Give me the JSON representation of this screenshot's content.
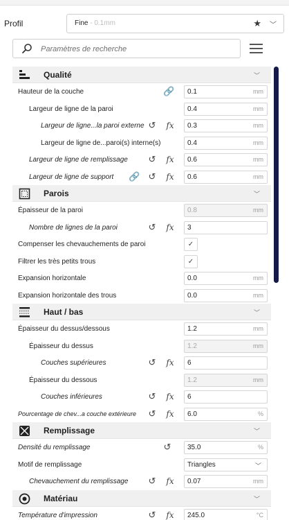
{
  "profile": {
    "label": "Profil",
    "value": "Fine",
    "sub": " - 0.1mm",
    "star_icon": "star-icon",
    "chevron_icon": "chevron-down-icon"
  },
  "search": {
    "placeholder": "Paramètres de recherche",
    "icon": "search-icon",
    "menu_icon": "menu-icon"
  },
  "colors": {
    "scrollbar": "#151a4a",
    "category_bg": "#f0f0f0",
    "disabled_field_bg": "#f3f3f3"
  },
  "categories": {
    "qualite": {
      "title": "Qualité",
      "icon": "quality-icon",
      "rows": {
        "r0": {
          "label": "Hauteur de la couche",
          "value": "0.1",
          "unit": "mm"
        },
        "r1": {
          "label": "Largeur de ligne de la paroi",
          "value": "0.4",
          "unit": "mm"
        },
        "r2": {
          "label": "Largeur de ligne...la paroi externe",
          "value": "0.3",
          "unit": "mm"
        },
        "r3": {
          "label": "Largeur de ligne de...paroi(s) interne(s)",
          "value": "0.4",
          "unit": "mm"
        },
        "r4": {
          "label": "Largeur de ligne de remplissage",
          "value": "0.6",
          "unit": "mm"
        },
        "r5": {
          "label": "Largeur de ligne de support",
          "value": "0.6",
          "unit": "mm"
        }
      }
    },
    "parois": {
      "title": "Parois",
      "icon": "walls-icon",
      "rows": {
        "r0": {
          "label": "Épaisseur de la paroi",
          "value": "0.8",
          "unit": "mm"
        },
        "r1": {
          "label": "Nombre de lignes de la paroi",
          "value": "3",
          "unit": ""
        },
        "r2": {
          "label": "Compenser les chevauchements de paroi",
          "checked": true
        },
        "r3": {
          "label": "Filtrer les très petits trous",
          "checked": true
        },
        "r4": {
          "label": "Expansion horizontale",
          "value": "0.0",
          "unit": "mm"
        },
        "r5": {
          "label": "Expansion horizontale des trous",
          "value": "0.0",
          "unit": "mm"
        }
      }
    },
    "hautbas": {
      "title": "Haut / bas",
      "icon": "top-bottom-icon",
      "rows": {
        "r0": {
          "label": "Épaisseur du dessus/dessous",
          "value": "1.2",
          "unit": "mm"
        },
        "r1": {
          "label": "Épaisseur du dessus",
          "value": "1.2",
          "unit": "mm"
        },
        "r2": {
          "label": "Couches supérieures",
          "value": "6",
          "unit": ""
        },
        "r3": {
          "label": "Épaisseur du dessous",
          "value": "1.2",
          "unit": "mm"
        },
        "r4": {
          "label": "Couches inférieures",
          "value": "6",
          "unit": ""
        },
        "r5": {
          "label": "Pourcentage de chev...a couche extérieure",
          "value": "6.0",
          "unit": "%"
        }
      }
    },
    "remplissage": {
      "title": "Remplissage",
      "icon": "infill-icon",
      "rows": {
        "r0": {
          "label": "Densité du remplissage",
          "value": "35.0",
          "unit": "%"
        },
        "r1": {
          "label": "Motif de remplissage",
          "value": "Triangles"
        },
        "r2": {
          "label": "Chevauchement du remplissage",
          "value": "0.07",
          "unit": "mm"
        }
      }
    },
    "materiau": {
      "title": "Matériau",
      "icon": "material-icon",
      "rows": {
        "r0": {
          "label": "Température d'impression",
          "value": "245.0",
          "unit": "°C"
        }
      }
    }
  }
}
